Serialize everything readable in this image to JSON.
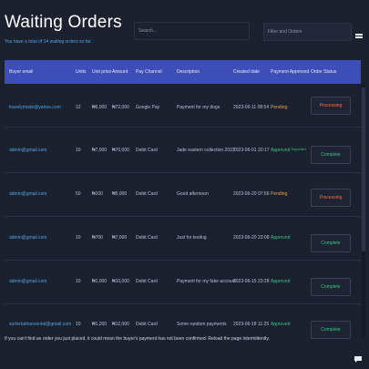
{
  "header": {
    "title": "Waiting Orders",
    "subtitle": "You have a total of 14 waiting orders so far."
  },
  "search": {
    "placeholder": "Search..."
  },
  "filter": {
    "placeholder": "Filter and Orders"
  },
  "table": {
    "columns": [
      "Buyer email",
      "Units",
      "Unit price",
      "Amount",
      "Pay Channel",
      "Description",
      "Created date",
      "Payment Approved",
      "Order Status"
    ],
    "rows": [
      {
        "email": "travelymode@yahoo.com",
        "units": "12",
        "unit_price": "₦6,000",
        "amount": "₦72,000",
        "pay_channel": "Google Pay",
        "description": "Payment for my dogs",
        "created": "2023-06-11 08:54",
        "payment": "Pending",
        "payment_note": "",
        "status": "Processing"
      },
      {
        "email": "admin@gmail.com",
        "units": "10",
        "unit_price": "₦7,000",
        "amount": "₦70,000",
        "pay_channel": "Debit Card",
        "description": "Jade eastern collection 2023",
        "created": "2023-06-01 20:17",
        "payment": "Approved",
        "payment_note": "Deposited",
        "status": "Complete"
      },
      {
        "email": "admin@gmail.com",
        "units": "50",
        "unit_price": "₦100",
        "amount": "₦5,000",
        "pay_channel": "Debit Card",
        "description": "Good afternoon",
        "created": "2023-06-20 07:56",
        "payment": "Pending",
        "payment_note": "",
        "status": "Processing"
      },
      {
        "email": "admin@gmail.com",
        "units": "10",
        "unit_price": "₦700",
        "amount": "₦7,000",
        "pay_channel": "Debit Card",
        "description": "Just for testing",
        "created": "2023-06-20 23:08",
        "payment": "Approved",
        "payment_note": "",
        "status": "Complete"
      },
      {
        "email": "admin@gmail.com",
        "units": "10",
        "unit_price": "₦1,000",
        "amount": "₦10,000",
        "pay_channel": "Debit Card",
        "description": "Payment for my fake account",
        "created": "2023-06-15 23:28",
        "payment": "Approved",
        "payment_note": "",
        "status": "Complete"
      },
      {
        "email": "surfertattoosrental@gmail.com",
        "units": "10",
        "unit_price": "₦1,200",
        "amount": "₦12,000",
        "pay_channel": "Debit Card",
        "description": "Some random payments",
        "created": "2023-06-18 11:25",
        "payment": "Approved",
        "payment_note": "",
        "status": "Complete"
      }
    ]
  },
  "footer": {
    "note": "If you can't find an order you just placed, it could mean the buyer's payment has not been confirmed. Reload the page intermittently."
  },
  "colors": {
    "background": "#1c2130",
    "header_bar": "#3d4eb8",
    "link": "#4da3e0",
    "approved": "#34c77b",
    "pending": "#e8a33a",
    "processing": "#ff6a3d"
  },
  "icons": {
    "menu": "menu-icon",
    "chat": "chat-icon"
  }
}
